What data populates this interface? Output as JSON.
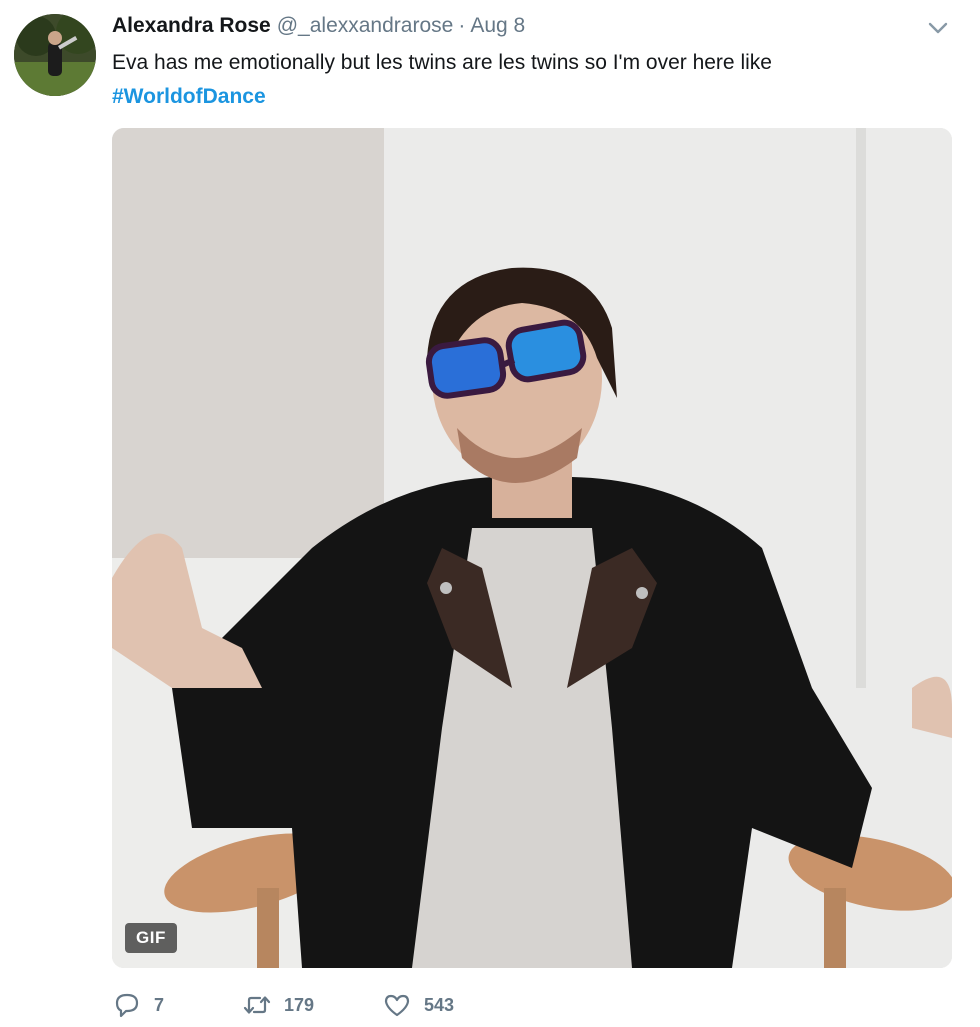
{
  "tweet": {
    "author_name": "Alexandra Rose",
    "handle": "@_alexxandrarose",
    "separator": "·",
    "date": "Aug 8",
    "text": "Eva has me emotionally but les twins are les twins so I'm over here like",
    "hashtag": "#WorldofDance",
    "media": {
      "badge": "GIF"
    },
    "stats": {
      "replies": "7",
      "retweets": "179",
      "likes": "543"
    }
  },
  "icons": {
    "more": "chevron-down-icon",
    "reply": "speech-bubble-icon",
    "retweet": "retweet-arrows-icon",
    "like": "heart-icon"
  },
  "colors": {
    "link": "#1b95e0",
    "secondary_text": "#657786",
    "primary_text": "#14171a"
  }
}
